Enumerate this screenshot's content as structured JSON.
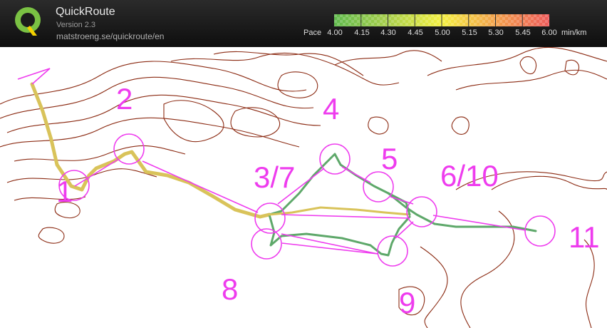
{
  "app": {
    "title": "QuickRoute",
    "version": "Version 2.3",
    "url": "matstroeng.se/quickroute/en"
  },
  "legend": {
    "label": "Pace",
    "ticks": [
      "4.00",
      "4.15",
      "4.30",
      "4.45",
      "5.00",
      "5.15",
      "5.30",
      "5.45",
      "6.00"
    ],
    "unit": "min/km",
    "colors": [
      "#5fba4c",
      "#a8cf4a",
      "#f4f040",
      "#f2a04a",
      "#ee5a5a"
    ]
  },
  "colors": {
    "contour": "#8b2a12",
    "course": "#ee3cee",
    "route_fast": "#5ea86a",
    "route_slow": "#d9c35a"
  },
  "controls": [
    "1",
    "2",
    "3/7",
    "4",
    "5",
    "6/10",
    "8",
    "9",
    "11"
  ]
}
